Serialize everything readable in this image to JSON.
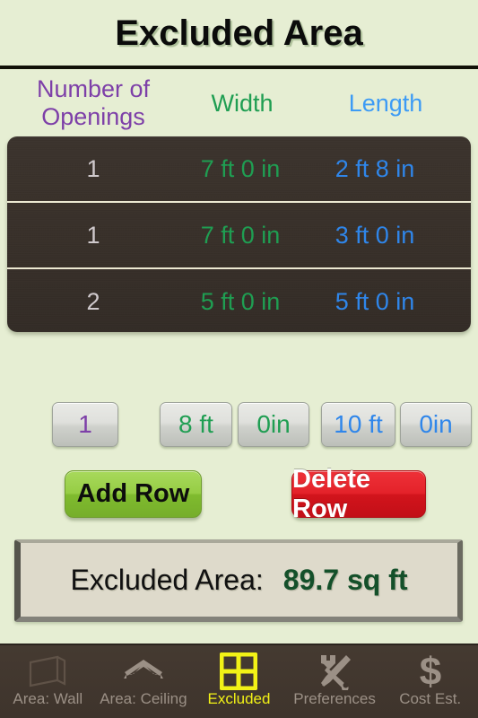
{
  "header": {
    "title": "Excluded Area"
  },
  "table": {
    "columns": [
      {
        "label": "Number of Openings",
        "color": "#7d3fa8"
      },
      {
        "label": "Width",
        "color": "#1f9e52"
      },
      {
        "label": "Length",
        "color": "#3d9bf5"
      }
    ],
    "rows": [
      {
        "count": "1",
        "width": "7 ft 0 in",
        "length": "2 ft 8 in"
      },
      {
        "count": "1",
        "width": "7 ft 0 in",
        "length": "3 ft 0 in"
      },
      {
        "count": "2",
        "width": "5 ft 0 in",
        "length": "5 ft 0 in"
      }
    ]
  },
  "steppers": {
    "count": "1",
    "width_ft": "8 ft",
    "width_in": "0in",
    "length_ft": "10 ft",
    "length_in": "0in"
  },
  "actions": {
    "add_label": "Add Row",
    "delete_label": "Delete Row"
  },
  "result": {
    "label": "Excluded Area:",
    "value": "89.7 sq ft"
  },
  "tabs": [
    {
      "label": "Area: Wall",
      "icon": "wall-slab-icon",
      "active": false
    },
    {
      "label": "Area: Ceiling",
      "icon": "roof-peak-icon",
      "active": false
    },
    {
      "label": "Excluded",
      "icon": "window-grid-icon",
      "active": true
    },
    {
      "label": "Preferences",
      "icon": "wrench-screwdriver-icon",
      "active": false
    },
    {
      "label": "Cost Est.",
      "icon": "dollar-sign-icon",
      "active": false
    }
  ],
  "colors": {
    "background": "#e6eed3",
    "table_fill": "#383029",
    "accent_purple": "#7d3fa8",
    "accent_green": "#1f9e52",
    "accent_blue": "#2f86ea",
    "active_tab": "#f2f216",
    "add_button": "#96cd44",
    "delete_button": "#e4222a",
    "result_text": "#14502a"
  }
}
